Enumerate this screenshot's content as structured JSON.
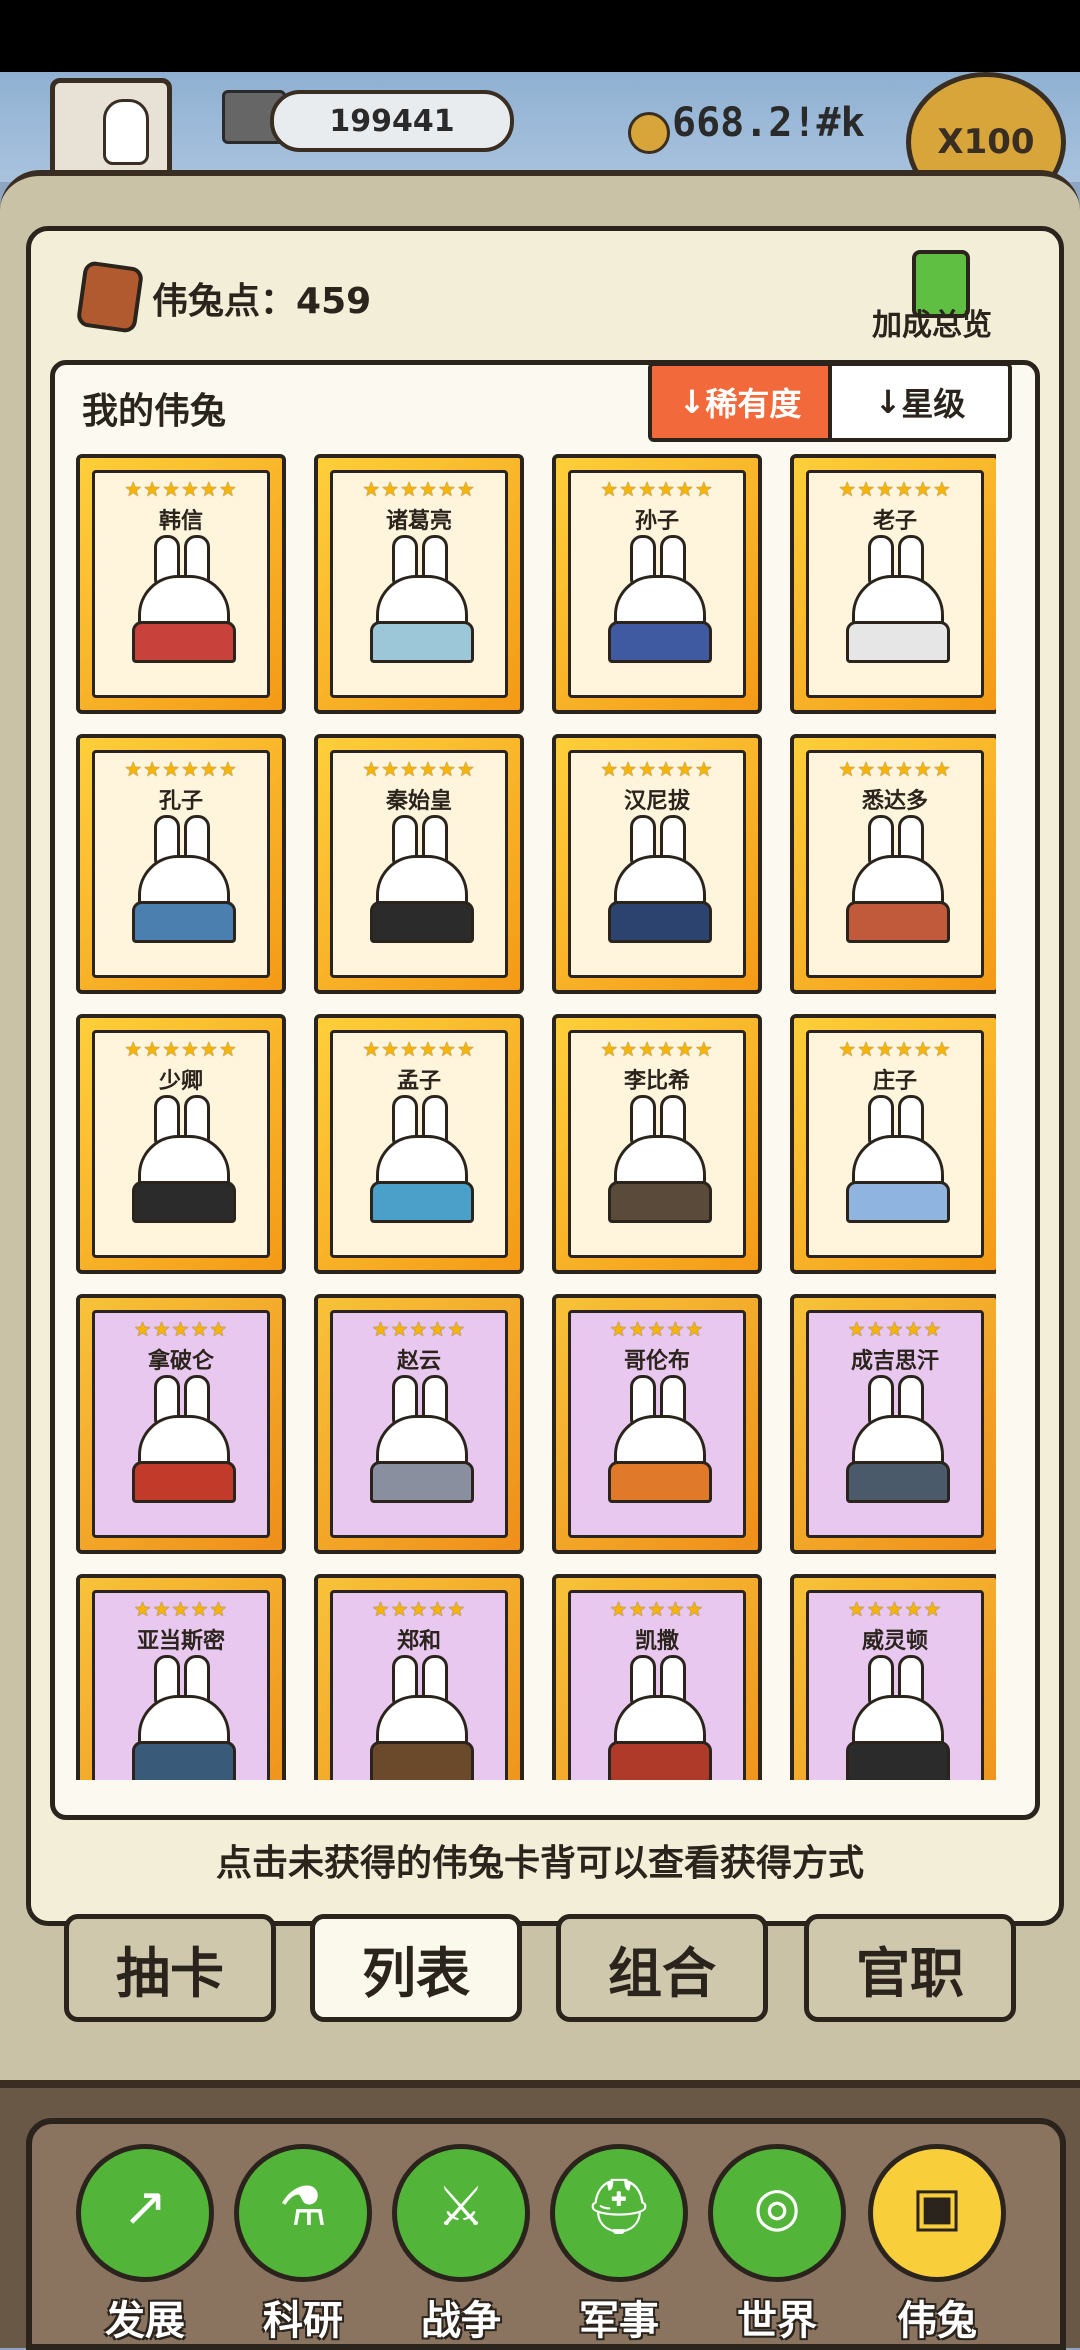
{
  "top": {
    "coins_value": "199441",
    "gold_value": "668.2!#k",
    "multiplier_label": "X100"
  },
  "panel": {
    "points_label": "伟兔点：",
    "points_value": "459",
    "bonus_label": "加成总览",
    "list_title": "我的伟兔",
    "sort_rarity": "稀有度",
    "sort_star": "星级",
    "hint": "点击未获得的伟兔卡背可以查看获得方式"
  },
  "cards": [
    {
      "name": "韩信",
      "stars": "★★★★★★",
      "frame": "gold",
      "robe": "#c8413a"
    },
    {
      "name": "诸葛亮",
      "stars": "★★★★★★",
      "frame": "gold",
      "robe": "#9bc7d8"
    },
    {
      "name": "孙子",
      "stars": "★★★★★★",
      "frame": "gold",
      "robe": "#3f5aa0"
    },
    {
      "name": "老子",
      "stars": "★★★★★★",
      "frame": "gold",
      "robe": "#e6e6e6"
    },
    {
      "name": "孔子",
      "stars": "★★★★★★",
      "frame": "gold",
      "robe": "#4a7fb0"
    },
    {
      "name": "秦始皇",
      "stars": "★★★★★★",
      "frame": "gold",
      "robe": "#2b2b2b"
    },
    {
      "name": "汉尼拔",
      "stars": "★★★★★★",
      "frame": "gold",
      "robe": "#2c4370"
    },
    {
      "name": "悉达多",
      "stars": "★★★★★★",
      "frame": "gold",
      "robe": "#c05a3a"
    },
    {
      "name": "少卿",
      "stars": "★★★★★★",
      "frame": "gold",
      "robe": "#2b2b2b"
    },
    {
      "name": "孟子",
      "stars": "★★★★★★",
      "frame": "gold",
      "robe": "#4aa0c8"
    },
    {
      "name": "李比希",
      "stars": "★★★★★★",
      "frame": "gold",
      "robe": "#5a4a3a"
    },
    {
      "name": "庄子",
      "stars": "★★★★★★",
      "frame": "gold",
      "robe": "#8fb4e0"
    },
    {
      "name": "拿破仑",
      "stars": "★★★★★",
      "frame": "purple",
      "robe": "#c23a2a"
    },
    {
      "name": "赵云",
      "stars": "★★★★★",
      "frame": "purple",
      "robe": "#8a8fa0"
    },
    {
      "name": "哥伦布",
      "stars": "★★★★★",
      "frame": "purple",
      "robe": "#e07a2a"
    },
    {
      "name": "成吉思汗",
      "stars": "★★★★★",
      "frame": "purple",
      "robe": "#4a5a6a"
    },
    {
      "name": "亚当斯密",
      "stars": "★★★★★",
      "frame": "purple",
      "robe": "#3a5a7a"
    },
    {
      "name": "郑和",
      "stars": "★★★★★",
      "frame": "purple",
      "robe": "#6a4a2a"
    },
    {
      "name": "凯撒",
      "stars": "★★★★★",
      "frame": "purple",
      "robe": "#b03a2a"
    },
    {
      "name": "威灵顿",
      "stars": "★★★★★",
      "frame": "purple",
      "robe": "#2b2b2b"
    }
  ],
  "tabs": [
    "抽卡",
    "列表",
    "组合",
    "官职"
  ],
  "active_tab": "列表",
  "nav": [
    {
      "label": "发展",
      "icon": "growth-arrow-icon"
    },
    {
      "label": "科研",
      "icon": "flask-icon"
    },
    {
      "label": "战争",
      "icon": "crossed-swords-icon"
    },
    {
      "label": "军事",
      "icon": "helmet-icon"
    },
    {
      "label": "世界",
      "icon": "globe-icon"
    },
    {
      "label": "伟兔",
      "icon": "bunny-portrait-icon"
    }
  ],
  "active_nav": "伟兔"
}
